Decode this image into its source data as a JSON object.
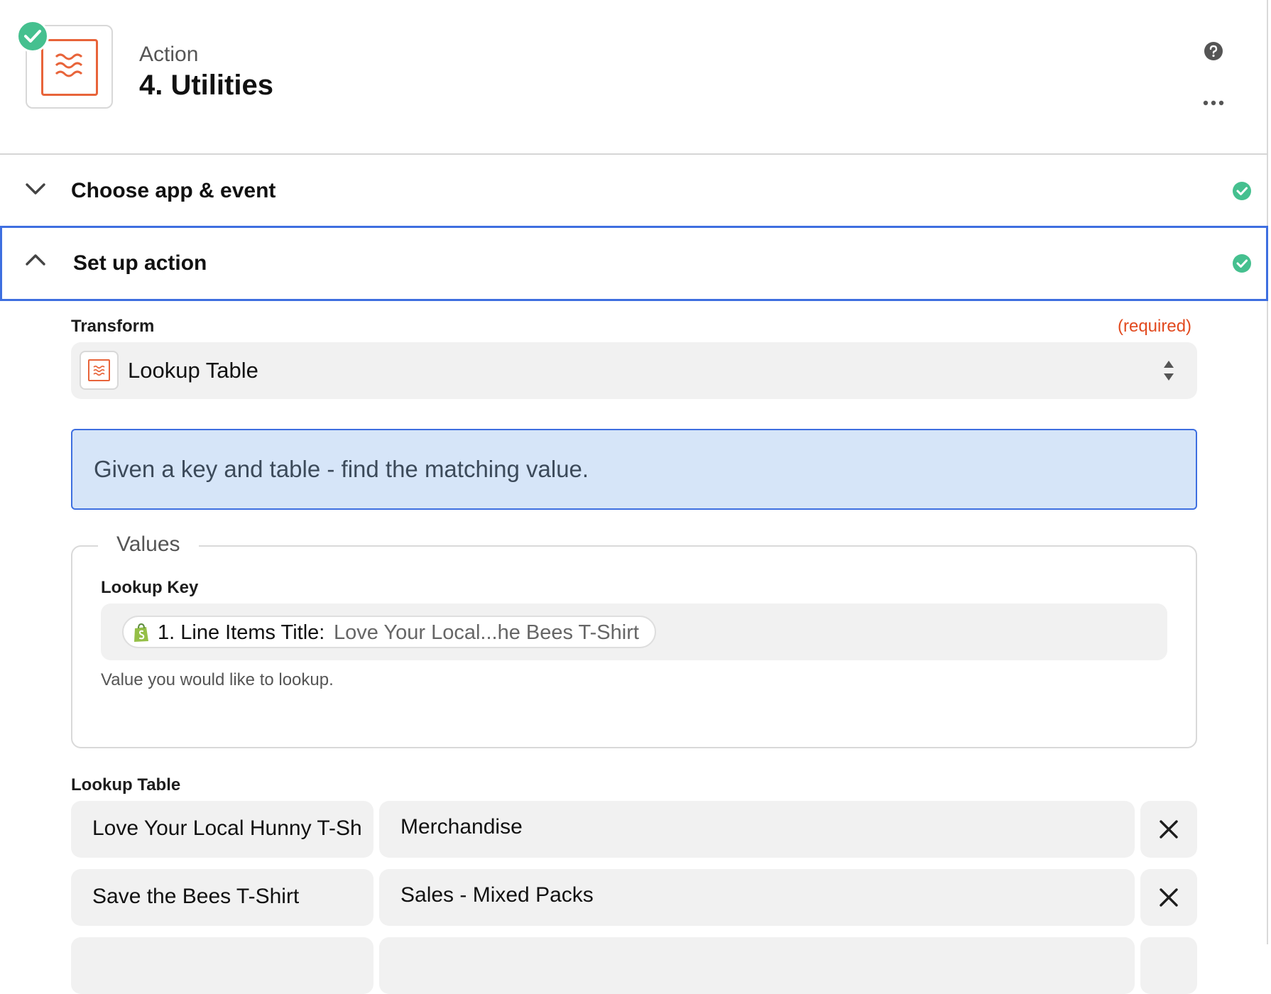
{
  "header": {
    "kicker": "Action",
    "title": "4. Utilities",
    "icons": [
      "check-icon",
      "formatter-icon",
      "help-icon",
      "more-icon"
    ]
  },
  "accordion": [
    {
      "label": "Choose app & event",
      "status": "complete"
    },
    {
      "label": "Set up action",
      "status": "complete"
    }
  ],
  "transform": {
    "label": "Transform",
    "required_text": "(required)",
    "selected": "Lookup Table"
  },
  "info": {
    "text": "Given a key and table - find the matching value."
  },
  "values": {
    "legend": "Values",
    "lookup_key": {
      "label": "Lookup Key",
      "pill_key": "1. Line Items Title:",
      "pill_value": "Love Your Local...he Bees T-Shirt",
      "help": "Value you would like to lookup."
    }
  },
  "lookup_table": {
    "label": "Lookup Table",
    "rows": [
      {
        "key": "Love Your Local Hunny T-Sh",
        "value": "Merchandise"
      },
      {
        "key": "Save the Bees T-Shirt",
        "value": "Sales - Mixed Packs"
      },
      {
        "key": "",
        "value": ""
      }
    ]
  },
  "colors": {
    "accent_blue": "#3e6fe0",
    "success_green": "#45c08f",
    "formatter_orange": "#e8643a",
    "required_red": "#e24a1f",
    "info_bg": "#d6e5f8"
  }
}
